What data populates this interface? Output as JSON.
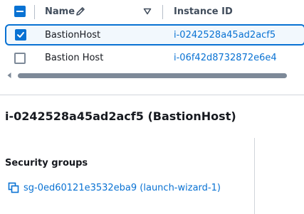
{
  "table": {
    "columns": [
      {
        "label": "Name"
      },
      {
        "label": "Instance ID"
      }
    ],
    "rows": [
      {
        "name": "BastionHost",
        "instance_id": "i-0242528a45ad2acf5",
        "selected": true
      },
      {
        "name": "Bastion Host",
        "instance_id": "i-06f42d8732872e6e4",
        "selected": false
      }
    ]
  },
  "details": {
    "title": "i-0242528a45ad2acf5 (BastionHost)",
    "security_groups_heading": "Security groups",
    "security_group_link": "sg-0ed60121e3532eba9 (launch-wizard-1)"
  },
  "colors": {
    "accent": "#0972d3",
    "selected_row_bg": "#f2f8fd",
    "header_text": "#414d5c"
  }
}
